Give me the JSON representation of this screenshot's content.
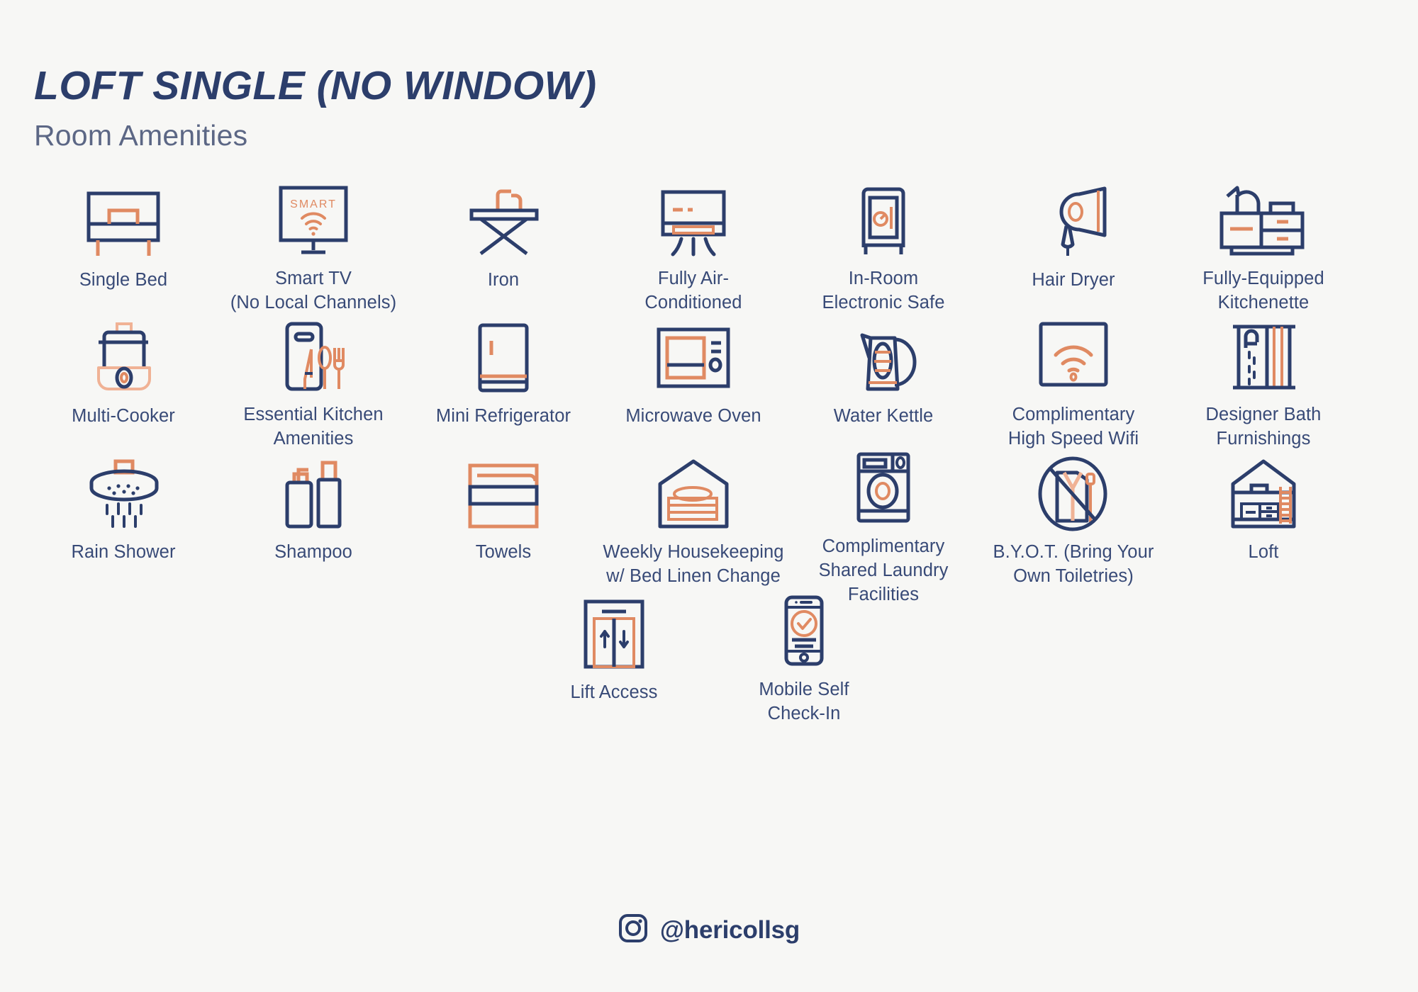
{
  "header": {
    "title": "LOFT SINGLE (NO WINDOW)",
    "subtitle": "Room Amenities"
  },
  "colors": {
    "background": "#f7f7f5",
    "navy": "#2c3e6b",
    "navy_text": "#384a77",
    "subtitle_gray": "#5c6785",
    "orange": "#e08a62",
    "orange_light": "#f0b295"
  },
  "amenities": {
    "row1": [
      {
        "label": "Single Bed",
        "icon": "single-bed-icon"
      },
      {
        "label": "Smart TV\n(No Local Channels)",
        "icon": "smart-tv-icon",
        "screen_text": "SMART"
      },
      {
        "label": "Iron",
        "icon": "iron-icon"
      },
      {
        "label": "Fully Air-\nConditioned",
        "icon": "air-conditioner-icon"
      },
      {
        "label": "In-Room\nElectronic Safe",
        "icon": "safe-icon"
      },
      {
        "label": "Hair Dryer",
        "icon": "hair-dryer-icon"
      },
      {
        "label": "Fully-Equipped\nKitchenette",
        "icon": "kitchenette-icon"
      }
    ],
    "row2": [
      {
        "label": "Multi-Cooker",
        "icon": "multi-cooker-icon"
      },
      {
        "label": "Essential Kitchen\nAmenities",
        "icon": "cutlery-board-icon"
      },
      {
        "label": "Mini Refrigerator",
        "icon": "mini-refrigerator-icon"
      },
      {
        "label": "Microwave Oven",
        "icon": "microwave-icon"
      },
      {
        "label": "Water Kettle",
        "icon": "kettle-icon"
      },
      {
        "label": "Complimentary\nHigh Speed Wifi",
        "icon": "wifi-icon"
      },
      {
        "label": "Designer Bath\nFurnishings",
        "icon": "shower-curtain-icon"
      }
    ],
    "row3": [
      {
        "label": "Rain Shower",
        "icon": "rain-shower-icon"
      },
      {
        "label": "Shampoo",
        "icon": "shampoo-bottles-icon"
      },
      {
        "label": "Towels",
        "icon": "towels-icon"
      },
      {
        "label": "Weekly Housekeeping\nw/ Bed Linen Change",
        "icon": "housekeeping-icon"
      },
      {
        "label": "Complimentary\nShared Laundry\nFacilities",
        "icon": "washing-machine-icon"
      },
      {
        "label": "B.Y.O.T. (Bring Your\nOwn Toiletries)",
        "icon": "no-toiletries-icon"
      },
      {
        "label": "Loft",
        "icon": "loft-house-icon"
      }
    ],
    "row4": [
      {
        "label": "Lift Access",
        "icon": "lift-icon"
      },
      {
        "label": "Mobile Self\nCheck-In",
        "icon": "mobile-checkin-icon"
      }
    ]
  },
  "footer": {
    "handle": "@hericollsg",
    "icon": "instagram-icon"
  }
}
